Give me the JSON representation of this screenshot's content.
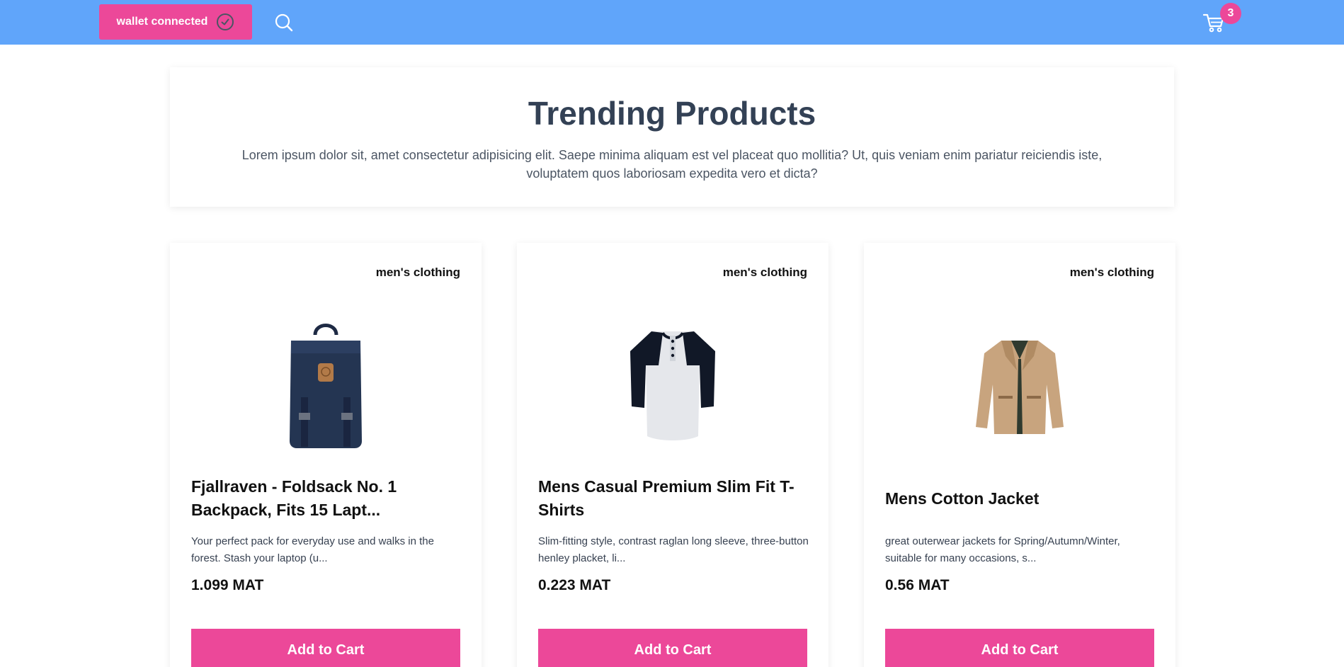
{
  "header": {
    "wallet_label": "wallet connected",
    "cart_count": "3",
    "accent_color": "#ec4899",
    "bar_color": "#60a5fa"
  },
  "hero": {
    "title": "Trending Products",
    "description": "Lorem ipsum dolor sit, amet consectetur adipisicing elit. Saepe minima aliquam est vel placeat quo mollitia? Ut, quis veniam enim pariatur reiciendis iste, voluptatem quos laboriosam expedita vero et dicta?"
  },
  "products": [
    {
      "category": "men's clothing",
      "title": "Fjallraven - Foldsack No. 1 Backpack, Fits 15 Lapt...",
      "description": "Your perfect pack for everyday use and walks in the forest. Stash your laptop (u...",
      "price": "1.099 MAT",
      "button_label": "Add to Cart",
      "image_icon": "backpack-image"
    },
    {
      "category": "men's clothing",
      "title": "Mens Casual Premium Slim Fit T-Shirts",
      "description": "Slim-fitting style, contrast raglan long sleeve, three-button henley placket, li...",
      "price": "0.223 MAT",
      "button_label": "Add to Cart",
      "image_icon": "tshirt-image"
    },
    {
      "category": "men's clothing",
      "title": "Mens Cotton Jacket",
      "description": "great outerwear jackets for Spring/Autumn/Winter, suitable for many occasions, s...",
      "price": "0.56 MAT",
      "button_label": "Add to Cart",
      "image_icon": "jacket-image"
    }
  ]
}
